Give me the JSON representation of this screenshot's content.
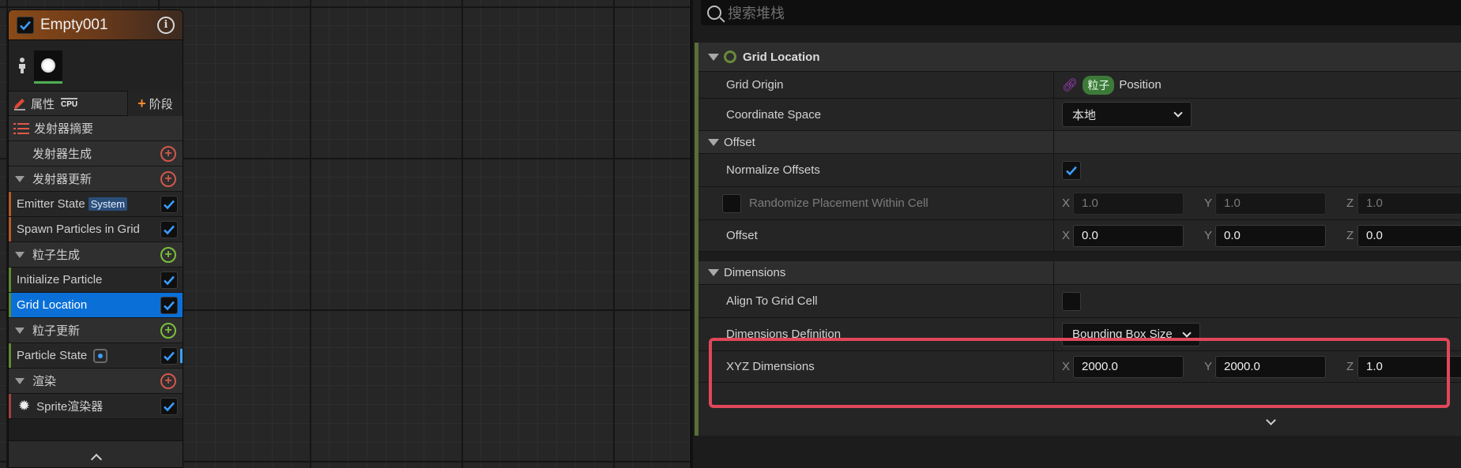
{
  "node": {
    "title": "Empty001",
    "toolbar": {
      "properties_label": "属性",
      "cpu_label": "CPU",
      "stage_label": "阶段"
    },
    "rows": [
      {
        "kind": "summary",
        "label": "发射器摘要"
      },
      {
        "kind": "plain",
        "label": "发射器生成",
        "add": "red"
      },
      {
        "kind": "section",
        "label": "发射器更新",
        "add": "red"
      },
      {
        "kind": "module",
        "label": "Emitter State",
        "badge": "System",
        "color": "orange"
      },
      {
        "kind": "module",
        "label": "Spawn Particles in Grid",
        "color": "orange"
      },
      {
        "kind": "section",
        "label": "粒子生成",
        "add": "green"
      },
      {
        "kind": "module",
        "label": "Initialize Particle",
        "color": "green"
      },
      {
        "kind": "module",
        "label": "Grid Location",
        "color": "green",
        "selected": true
      },
      {
        "kind": "section",
        "label": "粒子更新",
        "add": "green"
      },
      {
        "kind": "module",
        "label": "Particle State",
        "color": "green",
        "state_badge": true
      },
      {
        "kind": "section",
        "label": "渲染",
        "add": "red"
      },
      {
        "kind": "module",
        "label": "Sprite渲染器",
        "color": "red",
        "burst": true
      }
    ]
  },
  "search": {
    "placeholder": "搜索堆栈"
  },
  "panel": {
    "module_title": "Grid Location",
    "grid_origin": {
      "label": "Grid Origin",
      "tag": "粒子",
      "value": "Position"
    },
    "coordinate_space": {
      "label": "Coordinate Space",
      "value": "本地"
    },
    "offset_cat": "Offset",
    "normalize_offsets": {
      "label": "Normalize Offsets",
      "checked": true
    },
    "randomize": {
      "label": "Randomize Placement Within Cell",
      "x": "1.0",
      "y": "1.0",
      "z": "1.0"
    },
    "offset": {
      "label": "Offset",
      "x": "0.0",
      "y": "0.0",
      "z": "0.0"
    },
    "dimensions_cat": "Dimensions",
    "align_to_grid": {
      "label": "Align To Grid Cell",
      "checked": false
    },
    "dimensions_definition": {
      "label": "Dimensions Definition",
      "value": "Bounding Box Size"
    },
    "xyz_dimensions": {
      "label": "XYZ Dimensions",
      "x": "2000.0",
      "y": "2000.0",
      "z": "1.0"
    },
    "axis": {
      "x": "X",
      "y": "Y",
      "z": "Z"
    }
  },
  "colors": {
    "accent": "#0a70d8",
    "highlight": "#e0485a",
    "module_green": "#5d8a2e"
  }
}
